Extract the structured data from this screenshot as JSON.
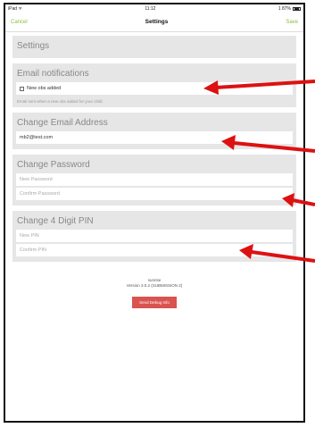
{
  "statusbar": {
    "left": "iPad ᯤ",
    "time": "11:12",
    "battery": "1 87%"
  },
  "navbar": {
    "cancel": "Cancel",
    "title": "Settings",
    "save": "Save"
  },
  "settings_header": "Settings",
  "email_notifications": {
    "title": "Email notifications",
    "checkbox_label": "New obs added",
    "hint": "Email sent when a new obs added for your child"
  },
  "change_email": {
    "title": "Change Email Address",
    "value": "mb2@test.com"
  },
  "change_password": {
    "title": "Change Password",
    "new_placeholder": "New Password",
    "confirm_placeholder": "Confirm Password"
  },
  "change_pin": {
    "title": "Change 4 Digit PIN",
    "new_placeholder": "New PIN",
    "confirm_placeholder": "Confirm PIN"
  },
  "footer": {
    "app": "sunrise",
    "version": "Version 3.0.2 (SUBMISSION 2)",
    "debug_button": "Send Debug Info"
  },
  "colors": {
    "accent": "#8bbd3c",
    "arrow": "#dd1111",
    "button": "#d9534f"
  }
}
